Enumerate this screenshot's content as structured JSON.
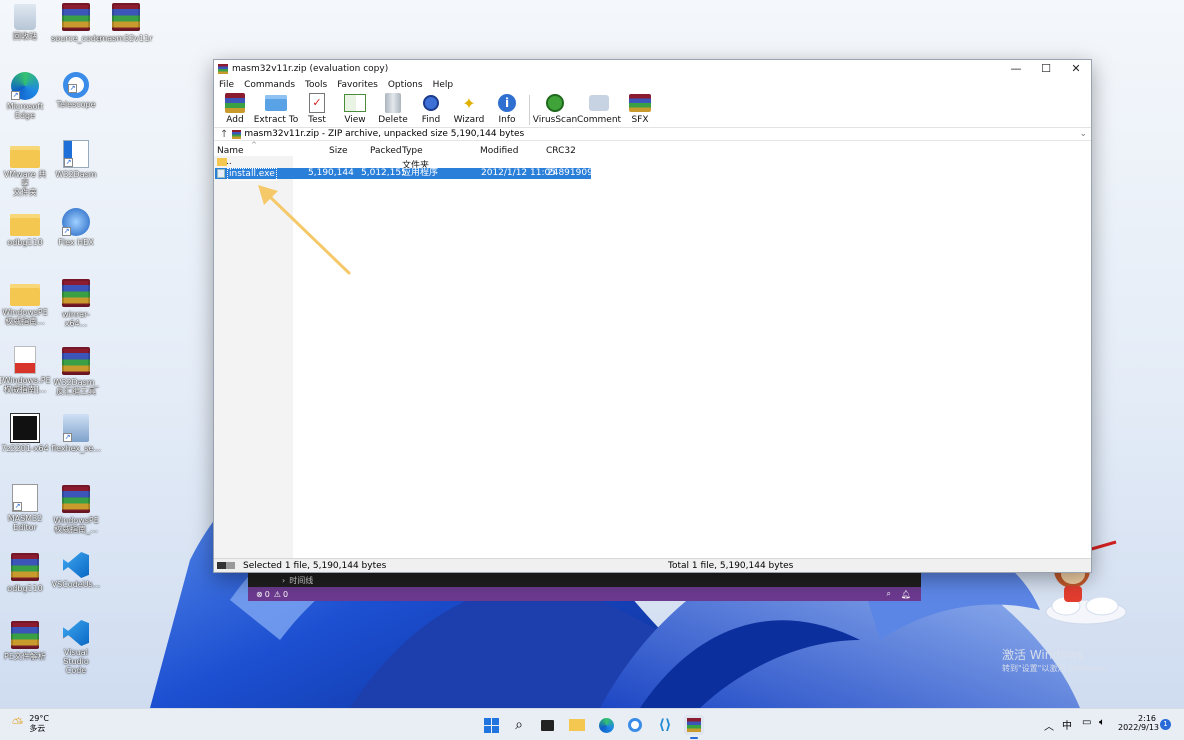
{
  "desktop": {
    "icons": [
      {
        "label": "回收站"
      },
      {
        "label": "source_code"
      },
      {
        "label": "masm32v11r"
      },
      {
        "label": "Microsoft\nEdge"
      },
      {
        "label": "Telescope"
      },
      {
        "label": "VMware 共享\n文件夹"
      },
      {
        "label": "W32Dasm"
      },
      {
        "label": "odbg110"
      },
      {
        "label": "Flex HEX"
      },
      {
        "label": "WindowsPE\n权威指南..."
      },
      {
        "label": "winrar-x64..."
      },
      {
        "label": "[Windows.PE\n权威指南]..."
      },
      {
        "label": "W32Dasm_\n反汇编工具"
      },
      {
        "label": "7z2201-x64"
      },
      {
        "label": "flexhex_se..."
      },
      {
        "label": "MASM32\nEditor"
      },
      {
        "label": "WindowsPE\n权威指南_..."
      },
      {
        "label": "odbg110"
      },
      {
        "label": "VSCodeUs..."
      },
      {
        "label": "PE文件解析"
      },
      {
        "label": "Visual Studio\nCode"
      }
    ],
    "activation": {
      "line1": "激活 Windows",
      "line2": "转到\"设置\"以激活 Windows。"
    }
  },
  "window": {
    "title": "masm32v11r.zip (evaluation copy)",
    "menu": [
      "File",
      "Commands",
      "Tools",
      "Favorites",
      "Options",
      "Help"
    ],
    "toolbar": [
      "Add",
      "Extract To",
      "Test",
      "View",
      "Delete",
      "Find",
      "Wizard",
      "Info",
      "VirusScan",
      "Comment",
      "SFX"
    ],
    "address": "masm32v11r.zip - ZIP archive, unpacked size 5,190,144 bytes",
    "columns": {
      "name": "Name",
      "size": "Size",
      "packed": "Packed",
      "type": "Type",
      "modified": "Modified",
      "crc": "CRC32"
    },
    "rows": [
      {
        "name": "..",
        "size": "",
        "packed": "",
        "type": "文件夹",
        "modified": "",
        "crc": ""
      },
      {
        "name": "install.exe",
        "size": "5,190,144",
        "packed": "5,012,155",
        "type": "应用程序",
        "modified": "2012/1/12 11:05",
        "crc": "24891909"
      }
    ],
    "status_left": "Selected 1 file, 5,190,144 bytes",
    "status_right": "Total 1 file, 5,190,144 bytes"
  },
  "vscode": {
    "timeline": "时间线",
    "errors": "0",
    "warnings": "0"
  },
  "taskbar": {
    "weather_temp": "29°C",
    "weather_desc": "多云",
    "ime": "中",
    "time": "2:16",
    "date": "2022/9/13",
    "notification_count": "1"
  },
  "colors": {
    "selection": "#2a7fd9",
    "vscode_status": "#6c3a8f",
    "arrow": "#f5c96a"
  }
}
